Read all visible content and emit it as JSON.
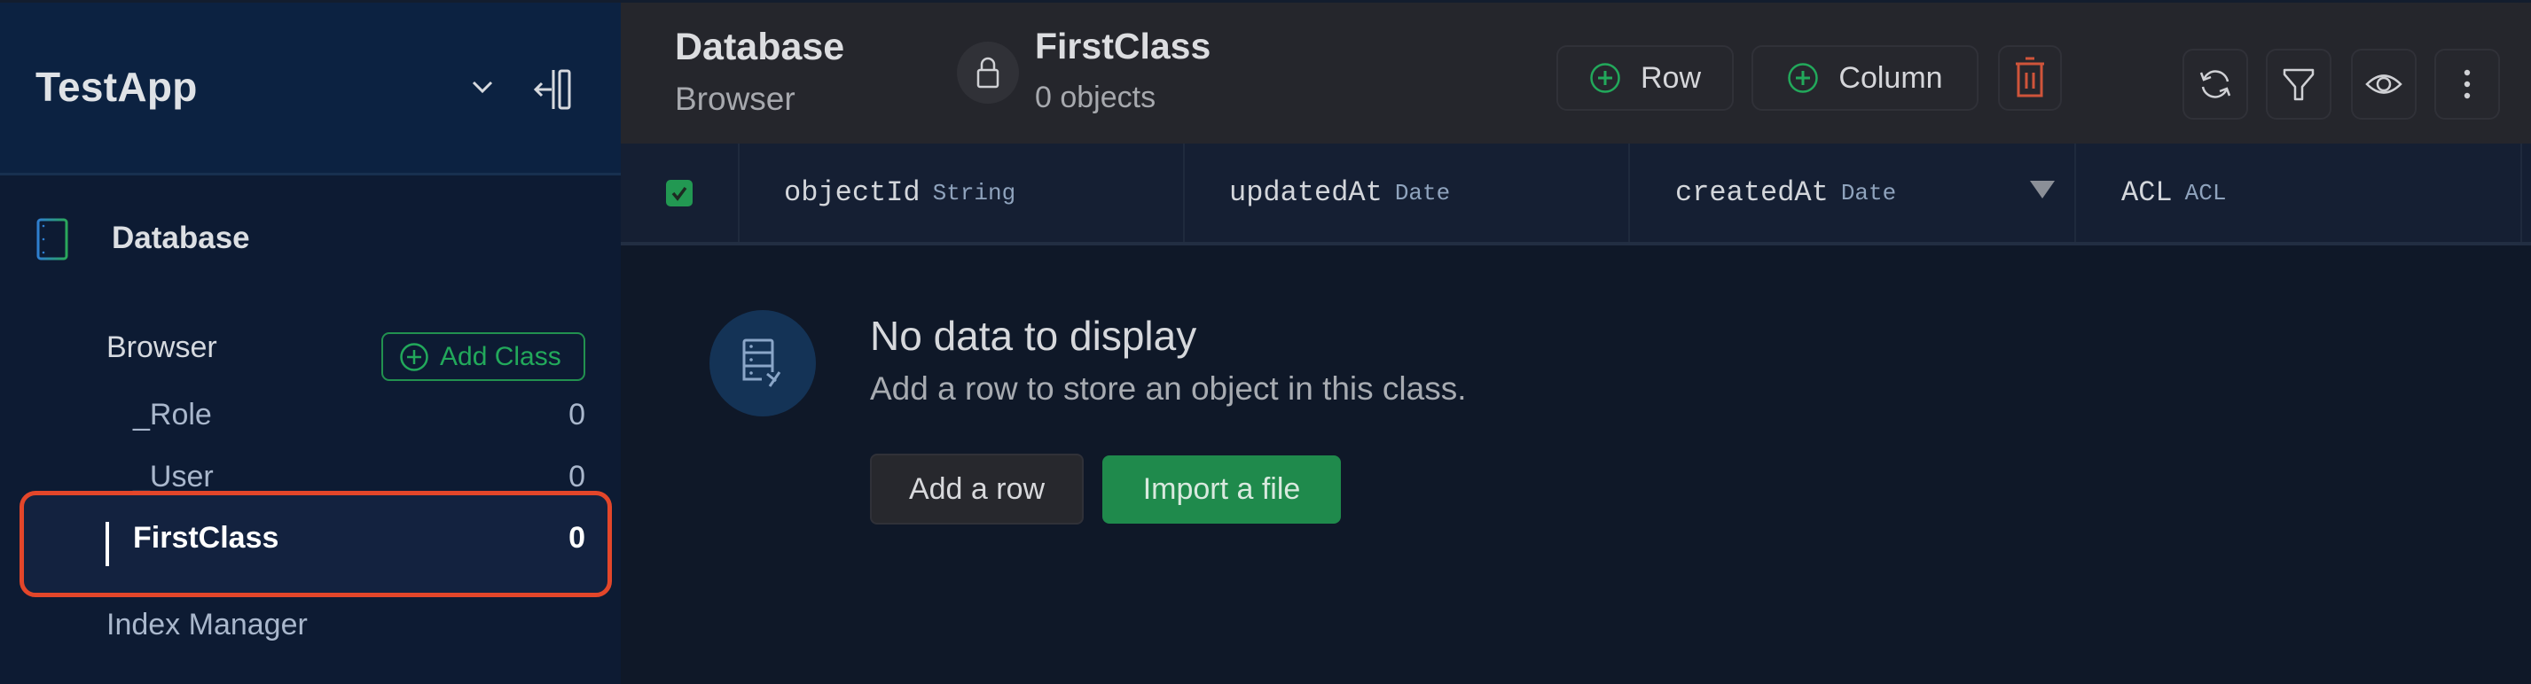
{
  "sidebar": {
    "app_name": "TestApp",
    "section": {
      "label": "Database",
      "icon": "database-icon"
    },
    "browser": {
      "label": "Browser",
      "add_class_label": "Add Class",
      "classes": [
        {
          "name": "_Role",
          "count": "0",
          "selected": false
        },
        {
          "name": "_User",
          "count": "0",
          "selected": false
        },
        {
          "name": "FirstClass",
          "count": "0",
          "selected": true
        }
      ]
    },
    "index_manager_label": "Index Manager"
  },
  "header": {
    "title": "Database",
    "subtitle": "Browser",
    "class_name": "FirstClass",
    "object_count": "0 objects",
    "buttons": {
      "row": "Row",
      "column": "Column",
      "delete": "trash-icon",
      "refresh": "refresh-icon",
      "filter": "filter-icon",
      "view": "eye-icon",
      "more": "more-vertical-icon"
    }
  },
  "table": {
    "select_all_checked": true,
    "columns": [
      {
        "name": "objectId",
        "type": "String",
        "sorted": false
      },
      {
        "name": "updatedAt",
        "type": "Date",
        "sorted": false
      },
      {
        "name": "createdAt",
        "type": "Date",
        "sorted": true,
        "sort_direction": "descending"
      },
      {
        "name": "ACL",
        "type": "ACL",
        "sorted": false
      }
    ]
  },
  "empty_state": {
    "title": "No data to display",
    "description": "Add a row to store an object in this class.",
    "add_row_label": "Add a row",
    "import_label": "Import a file"
  },
  "colors": {
    "accent_green": "#22a95b",
    "danger": "#e3462a",
    "highlight_outline": "#e3462a"
  }
}
